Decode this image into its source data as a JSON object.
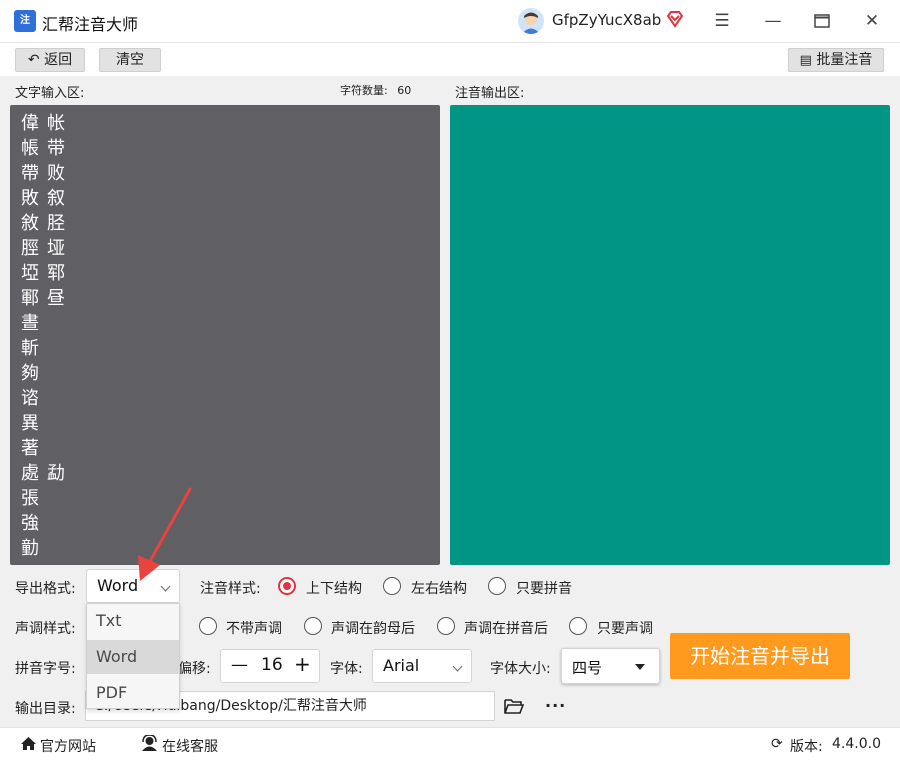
{
  "app": {
    "title": "汇帮注音大师",
    "username": "GfpZyYucX8ab"
  },
  "toolbar": {
    "back_label": "返回",
    "clear_label": "清空",
    "batch_label": "批量注音"
  },
  "input_area": {
    "label": "文字输入区:",
    "char_count_label": "字符数量:",
    "char_count": "60",
    "col1": [
      "偉",
      "帳",
      "帶",
      "敗",
      "敘",
      "脛",
      "埡",
      "鄆",
      "晝",
      "斬",
      "夠",
      "谘",
      "異",
      "著",
      "處",
      "張",
      "強",
      "勭"
    ],
    "col2": [
      "帐",
      "带",
      "败",
      "叙",
      "胫",
      "垭",
      "郓",
      "昼",
      "",
      "",
      "",
      "",
      "",
      "",
      "勐",
      "",
      "",
      ""
    ]
  },
  "output_area": {
    "label": "注音输出区:"
  },
  "settings": {
    "export_format_label": "导出格式:",
    "export_format_value": "Word",
    "export_options": [
      "Txt",
      "Word",
      "PDF"
    ],
    "annotation_style_label": "注音样式:",
    "annotation_styles": [
      "上下结构",
      "左右结构",
      "只要拼音"
    ],
    "annotation_style_selected": "上下结构",
    "tone_style_label": "声调样式:",
    "tone_styles": [
      "不带声调",
      "声调在韵母后",
      "声调在拼音后",
      "只要声调"
    ],
    "pinyin_size_label": "拼音字号:",
    "offset_label": "偏移:",
    "offset_value": "16",
    "font_label": "字体:",
    "font_value": "Arial",
    "font_size_label": "字体大小:",
    "font_size_value": "四号",
    "output_dir_label": "输出目录:",
    "output_dir_value": "C:/Users/Huibang/Desktop/汇帮注音大师",
    "start_label": "开始注音并导出"
  },
  "statusbar": {
    "website_label": "官方网站",
    "support_label": "在线客服",
    "version_label": "版本:",
    "version_value": "4.4.0.0"
  },
  "colors": {
    "input_bg": "#5f5f64",
    "output_bg": "#009584",
    "accent_orange": "#ff9a1f",
    "radio_red": "#e0353f",
    "annotation_arrow": "#e8433f"
  }
}
